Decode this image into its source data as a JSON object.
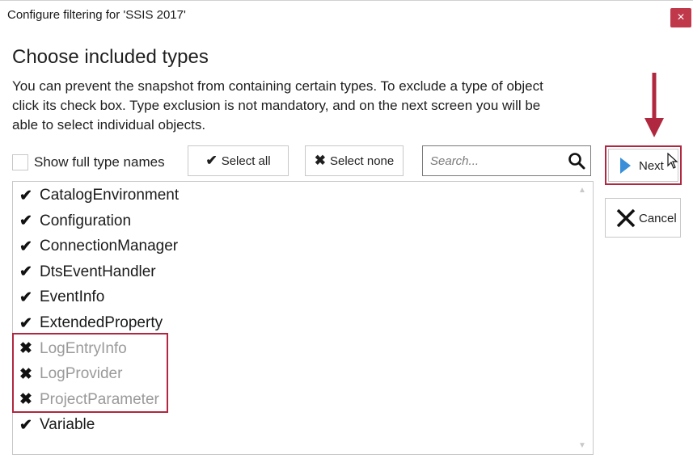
{
  "window": {
    "title": "Configure filtering for 'SSIS 2017'",
    "close_glyph": "×"
  },
  "heading": "Choose included types",
  "description": {
    "line1": "You can prevent the snapshot from containing certain types. To exclude a type of object",
    "line2": "click its check box. Type exclusion is not mandatory, and on the next screen you will be",
    "line3": "able to select individual objects."
  },
  "toolbar": {
    "show_full_label": "Show full type names",
    "show_full_checked": false,
    "select_all_label": "Select all",
    "select_all_icon": "checkmark-icon",
    "select_none_label": "Select none",
    "select_none_icon": "x-icon",
    "search_placeholder": "Search...",
    "search_icon": "magnifier-icon"
  },
  "types": [
    {
      "name": "CatalogEnvironment",
      "included": true,
      "mark": "✔"
    },
    {
      "name": "Configuration",
      "included": true,
      "mark": "✔"
    },
    {
      "name": "ConnectionManager",
      "included": true,
      "mark": "✔"
    },
    {
      "name": "DtsEventHandler",
      "included": true,
      "mark": "✔"
    },
    {
      "name": "EventInfo",
      "included": true,
      "mark": "✔"
    },
    {
      "name": "ExtendedProperty",
      "included": true,
      "mark": "✔"
    },
    {
      "name": "LogEntryInfo",
      "included": false,
      "mark": "✖"
    },
    {
      "name": "LogProvider",
      "included": false,
      "mark": "✖"
    },
    {
      "name": "ProjectParameter",
      "included": false,
      "mark": "✖"
    },
    {
      "name": "Variable",
      "included": true,
      "mark": "✔"
    }
  ],
  "actions": {
    "next_label": "Next",
    "cancel_label": "Cancel"
  },
  "colors": {
    "highlight": "#b0283f",
    "next_play": "#3a8fd8",
    "close_bg": "#c0394a",
    "excluded_text": "#9a9a9a"
  }
}
